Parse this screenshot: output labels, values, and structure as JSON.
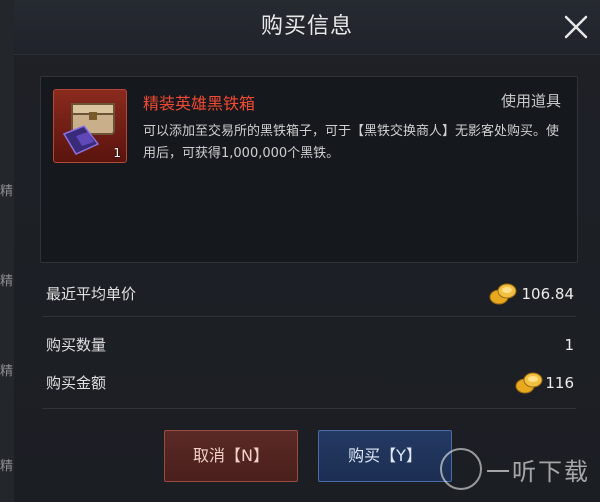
{
  "background": {
    "left_chars": [
      "精",
      "精",
      "精",
      "精",
      "精"
    ]
  },
  "dialog": {
    "title": "购买信息",
    "close_icon": "close-icon"
  },
  "item": {
    "name": "精装英雄黑铁箱",
    "type": "使用道具",
    "quantity": "1",
    "description": "可以添加至交易所的黑铁箱子，可于【黑铁交换商人】无影客处购买。使用后，可获得1,000,000个黑铁。",
    "icon": "treasure-chest-icon"
  },
  "rows": {
    "avg_price": {
      "label": "最近平均单价",
      "value": "106.84"
    },
    "quantity": {
      "label": "购买数量",
      "value": "1"
    },
    "total": {
      "label": "购买金额",
      "value": "116"
    }
  },
  "buttons": {
    "cancel": "取消【N】",
    "buy": "购买【Y】"
  },
  "watermark": {
    "text": "一听下载"
  },
  "colors": {
    "item_name": "#f24a32",
    "cancel_button": "#5a2a26",
    "buy_button": "#243a63"
  }
}
